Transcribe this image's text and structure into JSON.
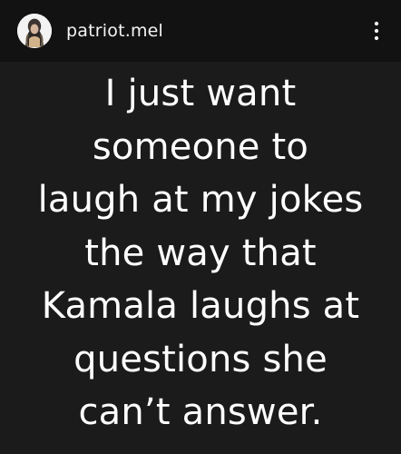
{
  "post": {
    "header": {
      "username": "patriot.mel",
      "avatar_icon": "profile-avatar",
      "menu_icon": "more-options-vertical-dots-icon"
    },
    "body": {
      "lines": [
        "I just want",
        "someone to",
        "laugh at my jokes",
        "the way that",
        "Kamala laughs at",
        "questions she",
        "can’t answer."
      ]
    }
  },
  "colors": {
    "header_background": "#121212",
    "post_background": "#1b1b1b",
    "text": "#ffffff"
  }
}
